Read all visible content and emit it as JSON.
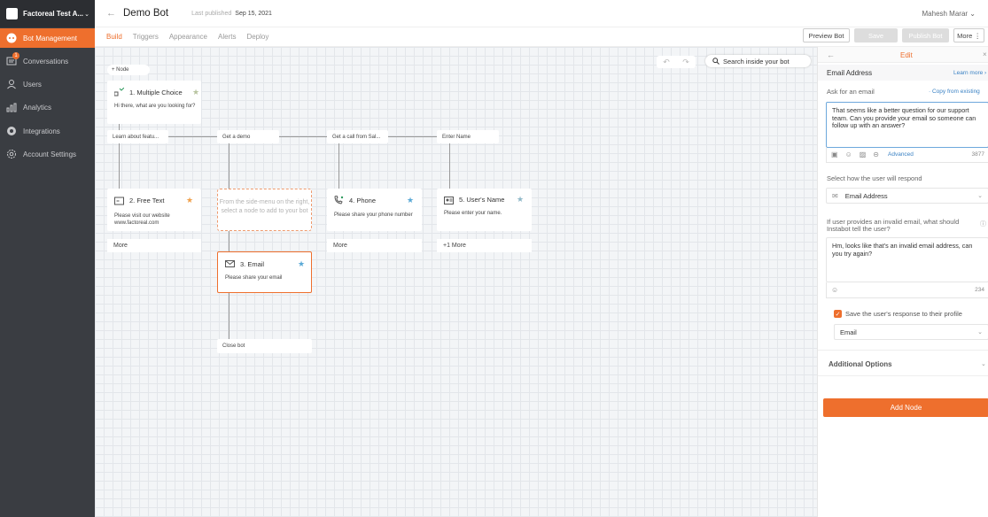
{
  "workspace": {
    "name": "Factoreal Test A..."
  },
  "sidebar": {
    "items": [
      {
        "label": "Bot Management",
        "icon": "bot-icon"
      },
      {
        "label": "Conversations",
        "icon": "chat-icon",
        "badge": "1"
      },
      {
        "label": "Users",
        "icon": "user-icon"
      },
      {
        "label": "Analytics",
        "icon": "analytics-icon"
      },
      {
        "label": "Integrations",
        "icon": "integrations-icon"
      },
      {
        "label": "Account Settings",
        "icon": "gear-icon"
      }
    ]
  },
  "header": {
    "back": "←",
    "title": "Demo Bot",
    "published_label": "Last published",
    "published_date": "Sep 15, 2021",
    "user": "Mahesh Marar ⌄"
  },
  "tabs": [
    "Build",
    "Triggers",
    "Appearance",
    "Alerts",
    "Deploy"
  ],
  "toolbar": {
    "preview": "Preview Bot",
    "save": "Save",
    "publish": "Publish Bot",
    "more": "More ⋮"
  },
  "canvas": {
    "add_node": "+ Node",
    "undo": "↶",
    "redo": "↷",
    "search_placeholder": "Search inside your bot",
    "nodes": {
      "multiple_choice": {
        "title": "1. Multiple Choice",
        "text": "Hi there, what are you looking for?"
      },
      "options": [
        "Learn about featu...",
        "Get a demo",
        "Get a call from Sal...",
        "Enter Name"
      ],
      "free_text": {
        "title": "2. Free Text",
        "text": "Please visit our website www.factoreal.com",
        "more": "More"
      },
      "placeholder": "From the side-menu on the right, select a node to add to your bot",
      "phone": {
        "title": "4. Phone",
        "text": "Please share your phone number",
        "more": "More"
      },
      "users_name": {
        "title": "5. User's Name",
        "text": "Please enter your name.",
        "more": "+1 More"
      },
      "email": {
        "title": "3. Email",
        "text": "Please share your email"
      },
      "close_bot": "Close bot"
    }
  },
  "panel": {
    "back": "←",
    "edit": "Edit",
    "close": "×",
    "title": "Email Address",
    "learn_more": "Learn more ›",
    "ask_label": "Ask for an email",
    "copy_from": "· Copy from existing",
    "question": "That seems like a better question for our support team. Can you provide your email so someone can follow up with an answer?",
    "advanced": "Advanced",
    "count1": "3877",
    "respond_label": "Select how the user will respond",
    "respond_value": "Email Address",
    "invalid_label": "If user provides an invalid email, what should Instabot tell the user?",
    "invalid_text": "Hm, looks like that's an invalid email address, can you try again?",
    "count2": "234",
    "save_label": "Save the user's response to their profile",
    "profile_field": "Email",
    "additional_options": "Additional Options",
    "add_node": "Add Node"
  },
  "colors": {
    "accent": "#ee6f2d",
    "sidebar": "#3a3d42",
    "link": "#3b82c4"
  }
}
